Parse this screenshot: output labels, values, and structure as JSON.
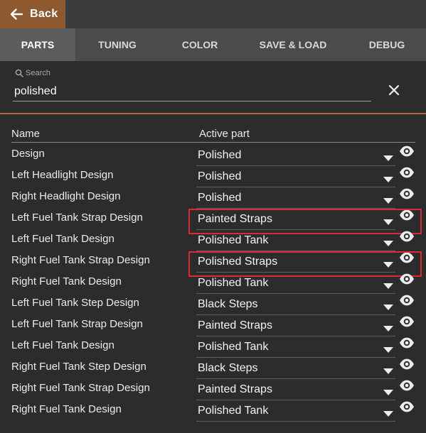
{
  "header": {
    "back_label": "Back"
  },
  "tabs": [
    {
      "label": "PARTS",
      "active": true
    },
    {
      "label": "TUNING",
      "active": false
    },
    {
      "label": "COLOR",
      "active": false
    },
    {
      "label": "SAVE & LOAD",
      "active": false
    },
    {
      "label": "DEBUG",
      "active": false
    }
  ],
  "search": {
    "caption": "Search",
    "value": "polished"
  },
  "table": {
    "col_name": "Name",
    "col_active": "Active part",
    "rows": [
      {
        "name": "Design",
        "value": "Polished",
        "highlighted": false
      },
      {
        "name": "Left Headlight Design",
        "value": "Polished",
        "highlighted": false
      },
      {
        "name": "Right Headlight Design",
        "value": "Polished",
        "highlighted": false
      },
      {
        "name": "Left Fuel Tank Strap Design",
        "value": "Painted Straps",
        "highlighted": true
      },
      {
        "name": "Left Fuel Tank Design",
        "value": "Polished Tank",
        "highlighted": false
      },
      {
        "name": "Right Fuel Tank Strap Design",
        "value": "Polished Straps",
        "highlighted": true
      },
      {
        "name": "Right Fuel Tank Design",
        "value": "Polished Tank",
        "highlighted": false
      },
      {
        "name": "Left Fuel Tank Step Design",
        "value": "Black Steps",
        "highlighted": false
      },
      {
        "name": "Left Fuel Tank Strap Design",
        "value": "Painted Straps",
        "highlighted": false
      },
      {
        "name": "Left Fuel Tank Design",
        "value": "Polished Tank",
        "highlighted": false
      },
      {
        "name": "Right Fuel Tank Step Design",
        "value": "Black Steps",
        "highlighted": false
      },
      {
        "name": "Right Fuel Tank Strap Design",
        "value": "Painted Straps",
        "highlighted": false
      },
      {
        "name": "Right Fuel Tank Design",
        "value": "Polished Tank",
        "highlighted": false
      }
    ]
  },
  "colors": {
    "accent": "#b8682e",
    "back_button": "#8f5930",
    "highlight": "#dc2a2f",
    "background": "#2b2c2e"
  },
  "icons": {
    "back": "arrow-left-icon",
    "search": "search-icon",
    "clear": "close-icon",
    "dropdown": "caret-down-icon",
    "visibility": "eye-icon"
  }
}
